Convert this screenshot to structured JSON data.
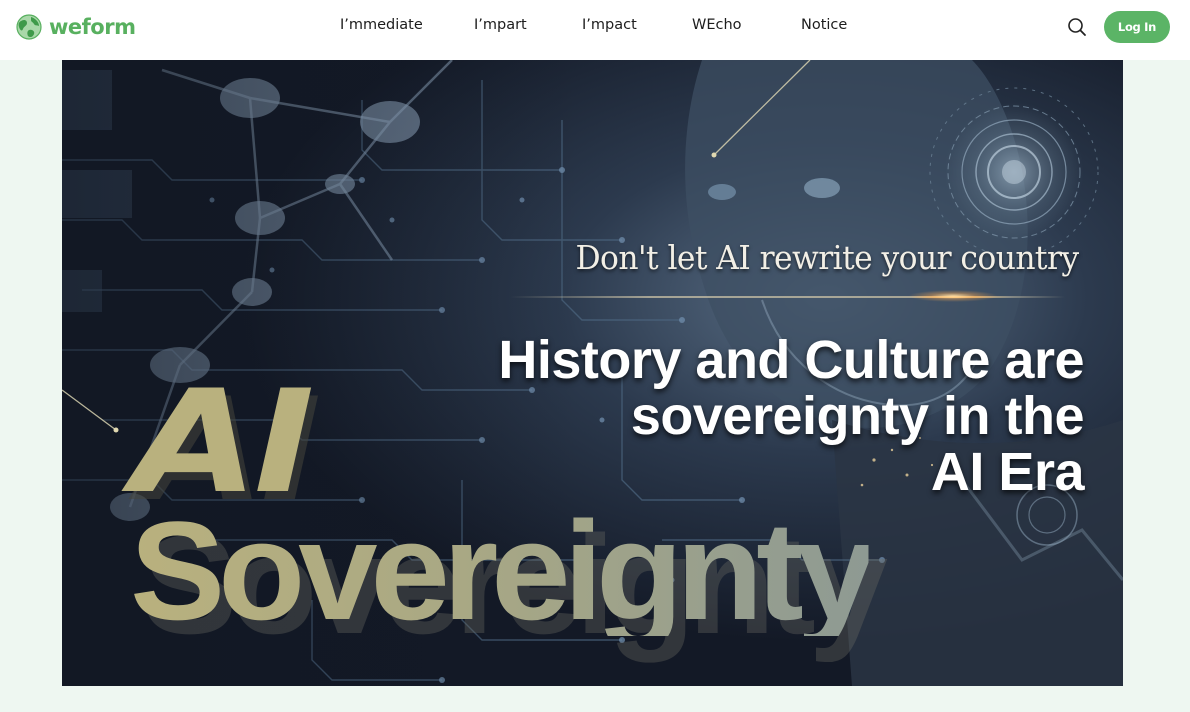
{
  "brand": {
    "name": "weform",
    "logo_icon": "globe-icon",
    "color": "#58b05f"
  },
  "nav": {
    "items": [
      {
        "label": "I’mmediate"
      },
      {
        "label": "I’mpart"
      },
      {
        "label": "I’mpact"
      },
      {
        "label": "WEcho"
      },
      {
        "label": "Notice"
      }
    ]
  },
  "header": {
    "search_icon": "search-icon",
    "login_label": "Log In",
    "login_color": "#5bb466"
  },
  "hero": {
    "tagline": "Don't let AI rewrite your country",
    "headline_lines": [
      "History and Culture are",
      "sovereignty in the",
      "AI Era"
    ],
    "big_text_line1": "AI",
    "big_text_line2": "Sovereignty"
  }
}
